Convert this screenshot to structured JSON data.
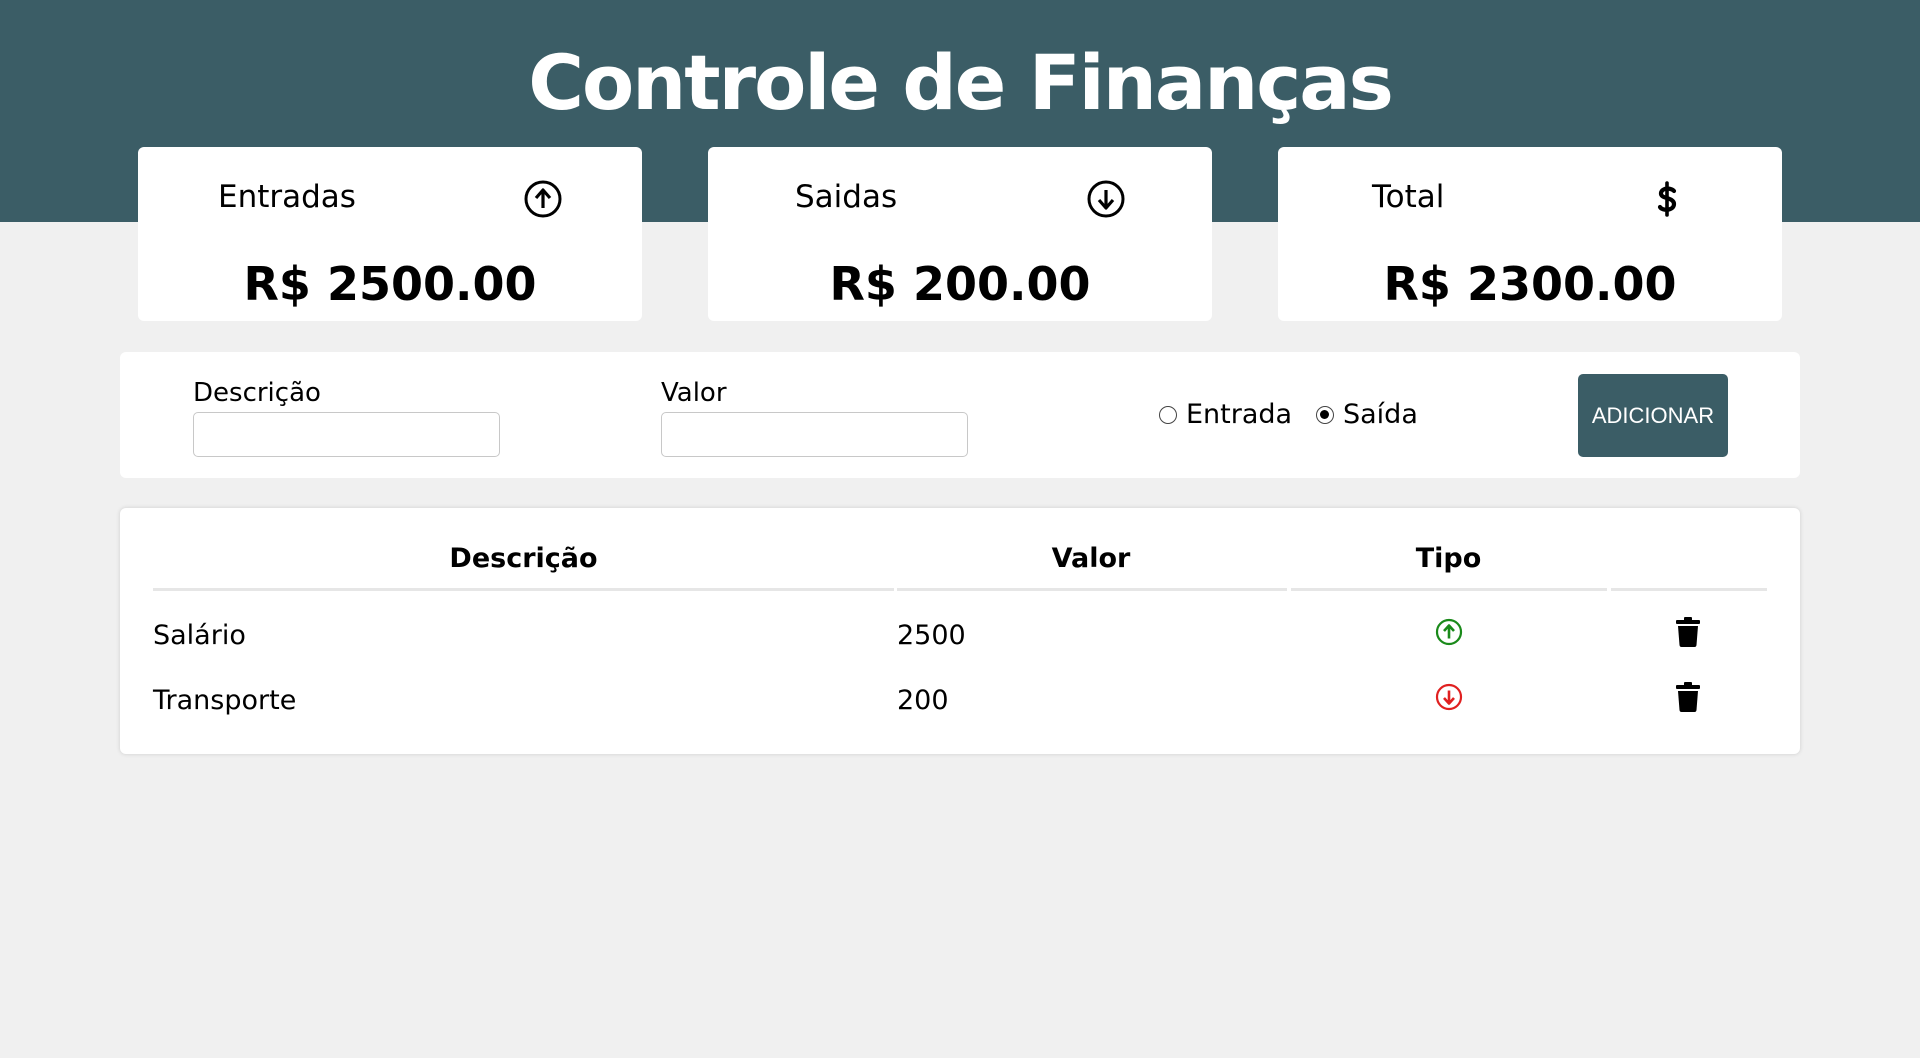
{
  "header": {
    "title": "Controle de Finanças"
  },
  "summary": [
    {
      "label": "Entradas",
      "icon": "arrow-up-circle-icon",
      "amount": "R$ 2500.00"
    },
    {
      "label": "Saidas",
      "icon": "arrow-down-circle-icon",
      "amount": "R$ 200.00"
    },
    {
      "label": "Total",
      "icon": "dollar-icon",
      "amount": "R$ 2300.00"
    }
  ],
  "form": {
    "description_label": "Descrição",
    "description_value": "",
    "value_label": "Valor",
    "value_value": "",
    "radio_entrada": "Entrada",
    "radio_saida": "Saída",
    "selected_type": "Saída",
    "add_button": "ADICIONAR"
  },
  "table": {
    "headers": [
      "Descrição",
      "Valor",
      "Tipo",
      ""
    ],
    "rows": [
      {
        "description": "Salário",
        "value": "2500",
        "type": "entrada",
        "type_icon": "arrow-up-circle-icon",
        "delete_icon": "trash-icon"
      },
      {
        "description": "Transporte",
        "value": "200",
        "type": "saida",
        "type_icon": "arrow-down-circle-icon",
        "delete_icon": "trash-icon"
      }
    ]
  },
  "colors": {
    "primary": "#3b5d66",
    "background": "#f0f0f0",
    "income": "#1a8a1a",
    "expense": "#e02020"
  }
}
